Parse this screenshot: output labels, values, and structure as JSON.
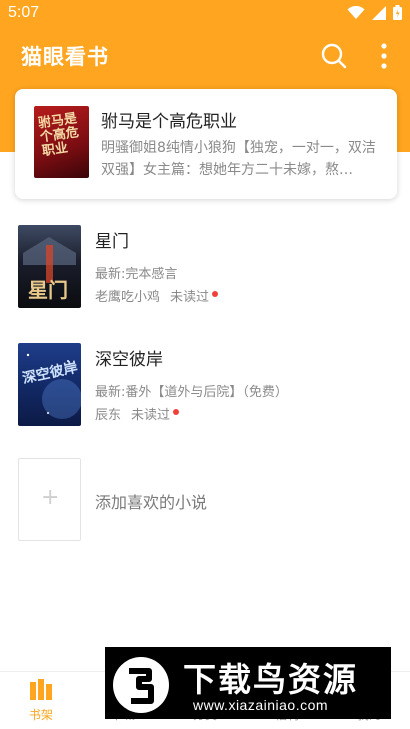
{
  "status_bar": {
    "time": "5:07"
  },
  "app": {
    "title": "猫眼看书",
    "icons": [
      "search-icon",
      "more-vert-icon"
    ],
    "accent_color": "#ffa51f"
  },
  "featured": {
    "cover_text": "驸马是个高危职业",
    "title": "驸马是个高危职业",
    "desc": "明骚御姐8纯情小狼狗【独宠，一对一，双洁双强】女主篇：想她年方二十未嫁，熬…"
  },
  "books": [
    {
      "title": "星门",
      "cover_text": "星门",
      "latest": "最新:完本感言",
      "author": "老鹰吃小鸡",
      "status": "未读过"
    },
    {
      "title": "深空彼岸",
      "cover_text": "深空彼岸",
      "latest": "最新:番外【道外与后院】（免费）",
      "author": "辰东",
      "status": "未读过"
    }
  ],
  "add_book": {
    "label": "添加喜欢的小说",
    "icon": "plus-icon"
  },
  "bottom_nav": {
    "items": [
      {
        "label": "书架",
        "icon": "bookshelf-icon",
        "active": true
      },
      {
        "label": "书城",
        "icon": "store-icon",
        "active": false
      },
      {
        "label": "分类",
        "icon": "category-icon",
        "active": false
      },
      {
        "label": "福利",
        "icon": "gift-icon",
        "active": false
      },
      {
        "label": "我的",
        "icon": "profile-icon",
        "active": false
      }
    ]
  },
  "watermark": {
    "main": "下载鸟资源",
    "sub": "www.xiazainiao.com"
  }
}
